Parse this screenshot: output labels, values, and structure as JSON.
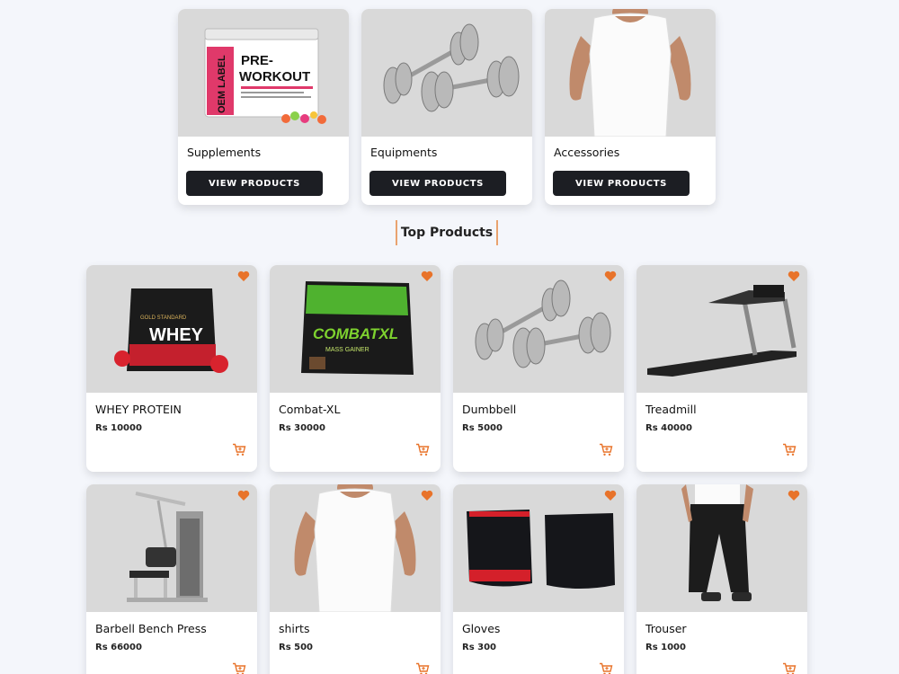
{
  "categories": [
    {
      "name": "Supplements",
      "button": "VIEW PRODUCTS",
      "label_big": "PRE-\nWORKOUT",
      "label_side": "OEM LABEL"
    },
    {
      "name": "Equipments",
      "button": "VIEW PRODUCTS"
    },
    {
      "name": "Accessories",
      "button": "VIEW PRODUCTS"
    }
  ],
  "section_title": "Top Products",
  "products": [
    {
      "name": "WHEY PROTEIN",
      "price": "Rs 10000",
      "pack_text": "WHEY",
      "pack_small": "GOLD STANDARD"
    },
    {
      "name": "Combat-XL",
      "price": "Rs 30000",
      "pack_text": "COMBATXL",
      "pack_small": "MASS GAINER"
    },
    {
      "name": "Dumbbell",
      "price": "Rs 5000"
    },
    {
      "name": "Treadmill",
      "price": "Rs 40000"
    },
    {
      "name": "Barbell Bench Press",
      "price": "Rs 66000"
    },
    {
      "name": "shirts",
      "price": "Rs 500"
    },
    {
      "name": "Gloves",
      "price": "Rs 300"
    },
    {
      "name": "Trouser",
      "price": "Rs 1000"
    }
  ],
  "colors": {
    "accent": "#e8732a",
    "button_bg": "#1c1e23",
    "card_image_bg": "#d9d9d9",
    "page_bg": "#f4f6fb"
  },
  "icons": {
    "wishlist": "heart-icon",
    "cart": "cart-icon"
  }
}
